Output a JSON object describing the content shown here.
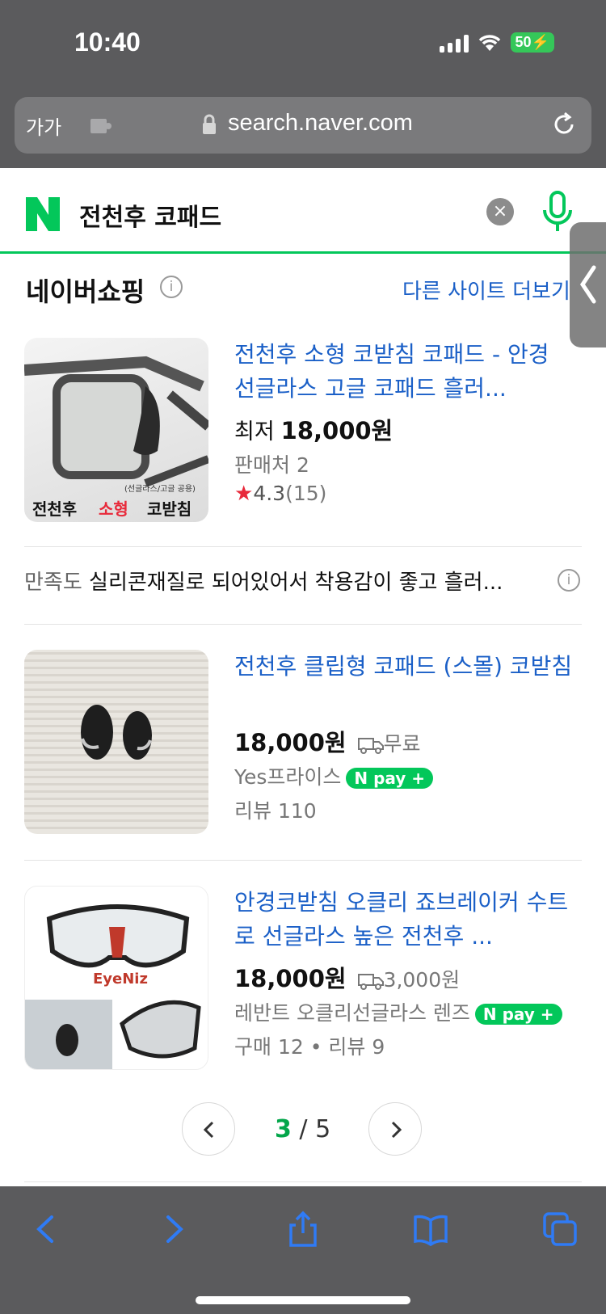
{
  "status_bar": {
    "time": "10:40",
    "battery": "50"
  },
  "browser": {
    "aa_label": "가가",
    "url": "search.naver.com"
  },
  "search": {
    "query": "전천후 코패드",
    "clear": "×"
  },
  "section": {
    "title": "네이버쇼핑",
    "more": "다른 사이트 더보기"
  },
  "products": [
    {
      "title": "전천후 소형 코받침 코패드 - 안경 선글라스 고글 코패드 흘러...",
      "price_prefix": "최저",
      "price": "18,000원",
      "sellers": "판매처 2",
      "rating": "4.3",
      "rating_count": "(15)",
      "thumb_text_1": "전천후",
      "thumb_text_2": "소형",
      "thumb_text_3": "코받침",
      "thumb_small": "(선글라스/고글 공용)"
    },
    {
      "title": "전천후 클립형 코패드 (스몰) 코받침",
      "price": "18,000원",
      "shipping": "무료",
      "seller": "Yes프라이스",
      "npay": "pay",
      "reviews": "리뷰 110"
    },
    {
      "title": "안경코받침 오클리 죠브레이커 수트로 선글라스 높은 전천후 ...",
      "price": "18,000원",
      "shipping": "3,000원",
      "seller": "레반트 오클리선글라스 렌즈",
      "npay": "pay",
      "purchases": "구매 12",
      "reviews": "리뷰 9",
      "thumb_logo": "EyeNiz"
    }
  ],
  "satisfaction": {
    "label": "만족도",
    "text": "실리콘재질로 되어있어서 착용감이 좋고 흘러..."
  },
  "pagination": {
    "current": "3",
    "separator": "/",
    "total": "5"
  },
  "colors": {
    "naver_green": "#03c75a",
    "link_blue": "#1a5fc7",
    "chrome_gray": "#5b5b5d"
  }
}
